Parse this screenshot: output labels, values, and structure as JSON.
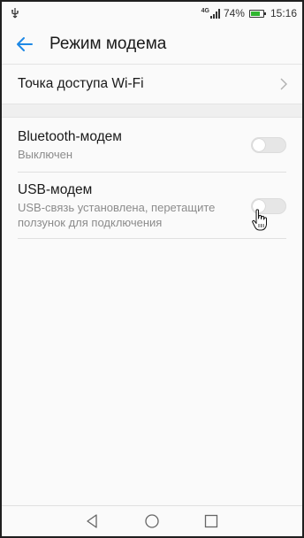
{
  "status_bar": {
    "network_type": "4G",
    "battery_percent": "74%",
    "battery_level": 0.74,
    "time": "15:16",
    "icons": [
      "usb-icon",
      "signal-icon",
      "battery-icon"
    ]
  },
  "header": {
    "title": "Режим модема",
    "back_icon": "back-arrow-icon"
  },
  "items": {
    "wifi_hotspot": {
      "label": "Точка доступа Wi-Fi",
      "icon": "chevron-right-icon"
    },
    "bluetooth": {
      "label": "Bluetooth-модем",
      "status": "Выключен",
      "enabled": false
    },
    "usb": {
      "label": "USB-модем",
      "status": "USB-связь установлена, перетащите ползунок для подключения",
      "enabled": false
    }
  },
  "nav_bar": {
    "icons": [
      "back-triangle-icon",
      "home-circle-icon",
      "recents-square-icon"
    ]
  },
  "colors": {
    "accent": "#1e88e5",
    "battery_fill": "#2fb52f",
    "background": "#fafafa"
  }
}
